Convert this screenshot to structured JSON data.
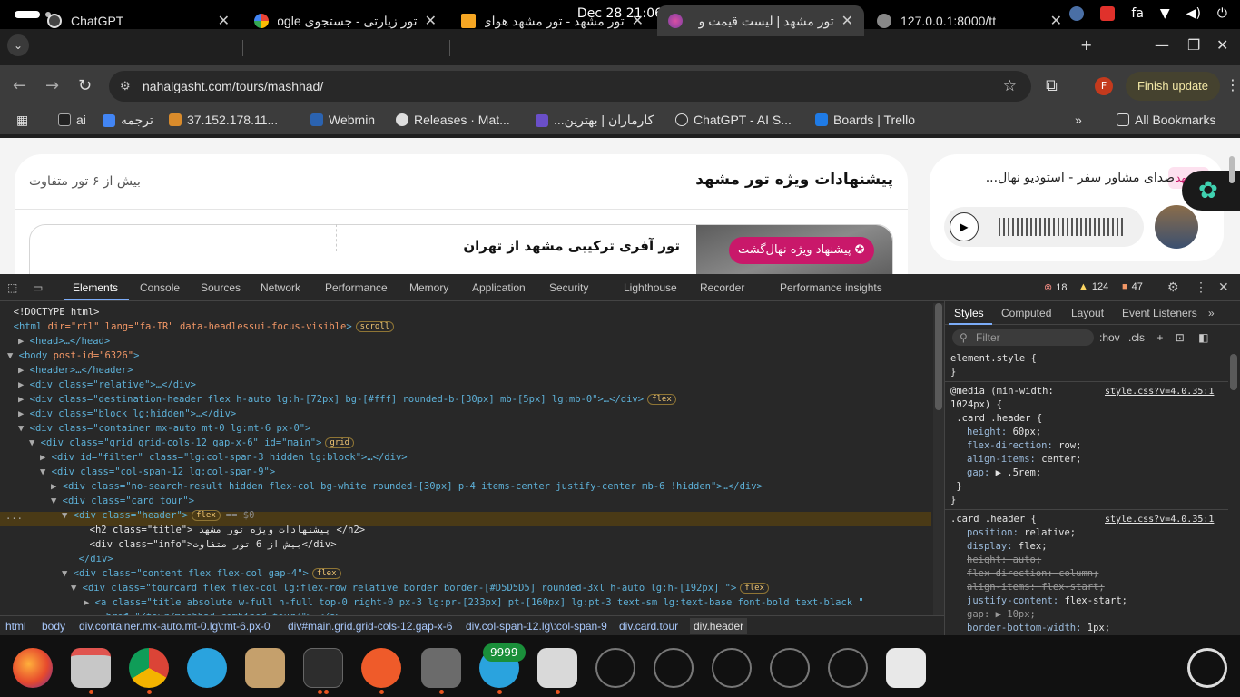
{
  "topbar": {
    "clock": "Dec 28  21:06",
    "lang": "fa"
  },
  "tabs": [
    {
      "title": "ChatGPT"
    },
    {
      "title": "تور زیارتی - جستجوی oogle"
    },
    {
      "title": "تور مشهد - تور مشهد هوای"
    },
    {
      "title": "تور مشهد | لیست قیمت و"
    },
    {
      "title": "127.0.0.1:8000/tt"
    }
  ],
  "toolbar": {
    "url": "nahalgasht.com/tours/mashhad/",
    "profile_initial": "F",
    "finish_update": "Finish update"
  },
  "bookmarks": [
    {
      "label": "ai"
    },
    {
      "label": "ترجمه"
    },
    {
      "label": "37.152.178.11..."
    },
    {
      "label": "Webmin"
    },
    {
      "label": "Releases · Mat..."
    },
    {
      "label": "کارماران | بهترین..."
    },
    {
      "label": "ChatGPT - AI S..."
    },
    {
      "label": "Boards | Trello"
    },
    {
      "label": "All Bookmarks"
    }
  ],
  "page": {
    "card_title": "پیشنهادات ویژه تور مشهد",
    "card_info": "بیش از ۶ تور متفاوت",
    "tour_title": "تور آفری ترکیبی مشهد از تهران",
    "badge": "پیشنهاد ویژه نهال‌گشت",
    "podcast_tag": "مشهد",
    "podcast_title": "صدای مشاور سفر - استودیو نهال..."
  },
  "devtools": {
    "tabs": [
      "Elements",
      "Console",
      "Sources",
      "Network",
      "Performance",
      "Memory",
      "Application",
      "Security",
      "Lighthouse",
      "Recorder",
      "Performance insights"
    ],
    "errors": "18",
    "warnings": "124",
    "issues": "47",
    "breadcrumbs": [
      "html",
      "body",
      "div.container.mx-auto.mt-0.lg\\:mt-6.px-0",
      "div#main.grid.grid-cols-12.gap-x-6",
      "div.col-span-12.lg\\:col-span-9",
      "div.card.tour",
      "div.header"
    ],
    "dom": [
      {
        "html": "<!DOCTYPE html>"
      },
      {
        "tag": "html",
        "attrs": "dir=\"rtl\" lang=\"fa-IR\" data-headlessui-focus-visible",
        "pill": "scroll"
      },
      {
        "text": "<head>…</head>"
      },
      {
        "tag": "body",
        "attrs": "post-id=\"6326\""
      },
      {
        "text": "<header>…</header>"
      },
      {
        "text": "<div class=\"relative\">…</div>"
      },
      {
        "text": "<div class=\"destination-header flex h-auto lg:h-[72px] bg-[#fff] rounded-b-[30px] mb-[5px] lg:mb-0\">…</div>",
        "pill": "flex"
      },
      {
        "text": "<div class=\"block lg:hidden\">…</div>"
      },
      {
        "text": "<div class=\"container mx-auto mt-0 lg:mt-6 px-0\">"
      },
      {
        "text": "<div class=\"grid grid-cols-12 gap-x-6\" id=\"main\">",
        "pill": "grid"
      },
      {
        "text": "<div id=\"filter\" class=\"lg:col-span-3 hidden lg:block\">…</div>"
      },
      {
        "text": "<div class=\"col-span-12 lg:col-span-9\">"
      },
      {
        "text": "<div class=\"no-search-result hidden flex-col bg-white rounded-[30px] p-4 items-center justify-center mb-6 !hidden\">…</div>"
      },
      {
        "text": "<div class=\"card tour\">"
      },
      {
        "text": "<div class=\"header\">",
        "pill": "flex",
        "suffix": "== $0"
      },
      {
        "text": "<h2 class=\"title\"> پیشنهادات ویژه تور مشهد </h2>"
      },
      {
        "text": "<div class=\"info\">بیش از 6 تور متفاوت</div>"
      },
      {
        "text": "</div>"
      },
      {
        "text": "<div class=\"content flex flex-col gap-4\">",
        "pill": "flex"
      },
      {
        "text": "<div class=\"tourcard flex flex-col lg:flex-row relative border border-[#D5D5D5] rounded-3xl h-auto lg:h-[192px] \">",
        "pill": "flex"
      },
      {
        "text": "<a class=\"title absolute w-full h-full top-0 right-0 px-3 lg:pr-[233px] pt-[160px] lg:pt-3 text-sm lg:text-base font-bold text-black \""
      },
      {
        "text": "href=\"/tour/mashhad-combined-tour/\">…</a>"
      }
    ],
    "styles_tabs": [
      "Styles",
      "Computed",
      "Layout",
      "Event Listeners"
    ],
    "filter_placeholder": "Filter",
    "hov": ":hov",
    "cls": ".cls",
    "css": [
      {
        "t": "element.style {"
      },
      {
        "t": "}"
      },
      {
        "t": "@media (min-width:",
        "src": "style.css?v=4.0.35:1"
      },
      {
        "t": "1024px) {"
      },
      {
        "t": " .card .header {"
      },
      {
        "p": "height",
        "v": "60px;"
      },
      {
        "p": "flex-direction",
        "v": "row;"
      },
      {
        "p": "align-items",
        "v": "center;"
      },
      {
        "p": "gap",
        "v": "▶ .5rem;"
      },
      {
        "t": " }"
      },
      {
        "t": "}"
      },
      {
        "t": ".card .header {",
        "src": "style.css?v=4.0.35:1"
      },
      {
        "p": "position",
        "v": "relative;"
      },
      {
        "p": "display",
        "v": "flex;"
      },
      {
        "p": "height",
        "v": "auto;",
        "strike": true
      },
      {
        "p": "flex-direction",
        "v": "column;",
        "strike": true
      },
      {
        "p": "align-items",
        "v": "flex-start;",
        "strike": true
      },
      {
        "p": "justify-content",
        "v": "flex-start;"
      },
      {
        "p": "gap",
        "v": "▶ 10px;",
        "strike": true
      },
      {
        "p": "border-bottom-width",
        "v": "1px;"
      }
    ]
  },
  "dock": {
    "badge": "9999"
  }
}
